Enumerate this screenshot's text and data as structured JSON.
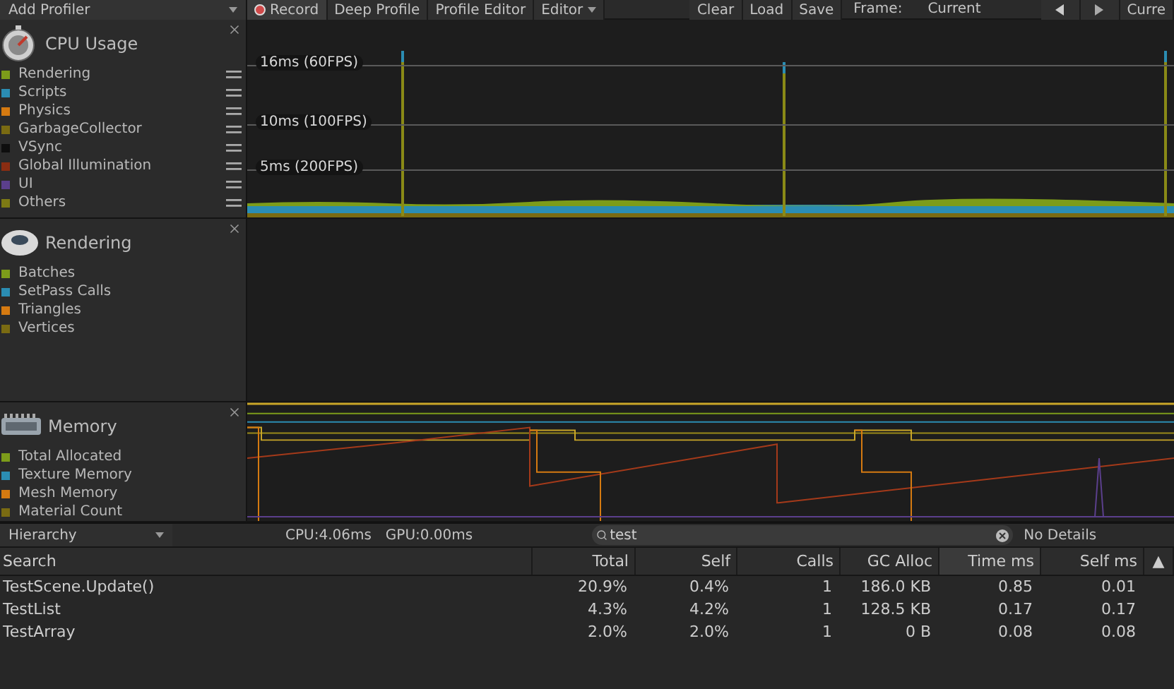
{
  "toolbar": {
    "add_profiler": "Add Profiler",
    "items": [
      {
        "kind": "record",
        "label": "Record"
      },
      {
        "kind": "button",
        "label": "Deep Profile"
      },
      {
        "kind": "button",
        "label": "Profile Editor"
      },
      {
        "kind": "dropdown",
        "label": "Editor"
      },
      {
        "kind": "spacer"
      },
      {
        "kind": "button",
        "label": "Clear"
      },
      {
        "kind": "button",
        "label": "Load"
      },
      {
        "kind": "button",
        "label": "Save"
      },
      {
        "kind": "text",
        "label": "Frame:"
      },
      {
        "kind": "value",
        "label": "Current"
      },
      {
        "kind": "prev"
      },
      {
        "kind": "next"
      },
      {
        "kind": "button",
        "label": "Curre"
      }
    ]
  },
  "modules": [
    {
      "kind": "cpu",
      "title": "CPU Usage",
      "legend": [
        {
          "name": "Rendering",
          "color": "#7d9c1a"
        },
        {
          "name": "Scripts",
          "color": "#2b8db3"
        },
        {
          "name": "Physics",
          "color": "#d57a11"
        },
        {
          "name": "GarbageCollector",
          "color": "#7a6b12"
        },
        {
          "name": "VSync",
          "color": "#0e0e0e"
        },
        {
          "name": "Global Illumination",
          "color": "#8a2d12"
        },
        {
          "name": "UI",
          "color": "#5b3f8c"
        },
        {
          "name": "Others",
          "color": "#7d7a14"
        }
      ],
      "guides": [
        "16ms (60FPS)",
        "10ms (100FPS)",
        "5ms (200FPS)"
      ]
    },
    {
      "kind": "rendering",
      "title": "Rendering",
      "legend": [
        {
          "name": "Batches",
          "color": "#7d9c1a"
        },
        {
          "name": "SetPass Calls",
          "color": "#2b8db3"
        },
        {
          "name": "Triangles",
          "color": "#d57a11"
        },
        {
          "name": "Vertices",
          "color": "#7a6b12"
        }
      ]
    },
    {
      "kind": "memory",
      "title": "Memory",
      "legend": [
        {
          "name": "Total Allocated",
          "color": "#7d9c1a"
        },
        {
          "name": "Texture Memory",
          "color": "#2b8db3"
        },
        {
          "name": "Mesh Memory",
          "color": "#d57a11"
        },
        {
          "name": "Material Count",
          "color": "#7a6b12"
        }
      ]
    }
  ],
  "details_bar": {
    "view": "Hierarchy",
    "cpu": "CPU:4.06ms",
    "gpu": "GPU:0.00ms",
    "search": "test",
    "details": "No Details"
  },
  "table": {
    "columns": [
      {
        "label": "Search",
        "selected": false
      },
      {
        "label": "Total",
        "selected": false
      },
      {
        "label": "Self",
        "selected": false
      },
      {
        "label": "Calls",
        "selected": false
      },
      {
        "label": "GC Alloc",
        "selected": false
      },
      {
        "label": "Time ms",
        "selected": true
      },
      {
        "label": "Self ms",
        "selected": false
      }
    ],
    "sort_mark": "▲",
    "rows": [
      [
        "TestScene.Update()",
        "20.9%",
        "0.4%",
        "1",
        "186.0 KB",
        "0.85",
        "0.01"
      ],
      [
        "TestList",
        "4.3%",
        "4.2%",
        "1",
        "128.5 KB",
        "0.17",
        "0.17"
      ],
      [
        "TestArray",
        "2.0%",
        "2.0%",
        "1",
        "0 B",
        "0.08",
        "0.08"
      ]
    ]
  }
}
